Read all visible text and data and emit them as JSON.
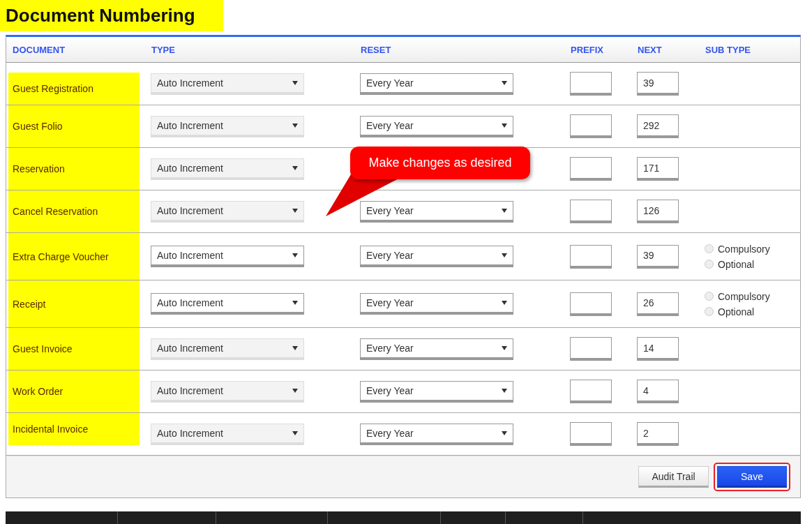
{
  "title": "Document Numbering",
  "columns": [
    "DOCUMENT",
    "TYPE",
    "RESET",
    "PREFIX",
    "NEXT",
    "SUB TYPE"
  ],
  "rows": [
    {
      "document": "Guest Registration",
      "type": {
        "value": "Auto Increment",
        "disabled": true
      },
      "reset": "Every Year",
      "prefix": "",
      "next": "39"
    },
    {
      "document": "Guest Folio",
      "type": {
        "value": "Auto Increment",
        "disabled": true
      },
      "reset": "Every Year",
      "prefix": "",
      "next": "292"
    },
    {
      "document": "Reservation",
      "type": {
        "value": "Auto Increment",
        "disabled": true
      },
      "prefix": "",
      "next": "171"
    },
    {
      "document": "Cancel Reservation",
      "type": {
        "value": "Auto Increment",
        "disabled": true
      },
      "reset": "Every Year",
      "prefix": "",
      "next": "126"
    },
    {
      "document": "Extra Charge Voucher",
      "type": {
        "value": "Auto Increment",
        "disabled": false
      },
      "reset": "Every Year",
      "prefix": "",
      "next": "39",
      "sub_types": [
        {
          "label": "Compulsory",
          "selected": false
        },
        {
          "label": "Optional",
          "selected": false
        }
      ]
    },
    {
      "document": "Receipt",
      "type": {
        "value": "Auto Increment",
        "disabled": false
      },
      "reset": "Every Year",
      "prefix": "",
      "next": "26",
      "sub_types": [
        {
          "label": "Compulsory",
          "selected": false
        },
        {
          "label": "Optional",
          "selected": false
        }
      ]
    },
    {
      "document": "Guest Invoice",
      "type": {
        "value": "Auto Increment",
        "disabled": true
      },
      "reset": "Every Year",
      "prefix": "",
      "next": "14"
    },
    {
      "document": "Work Order",
      "type": {
        "value": "Auto Increment",
        "disabled": true
      },
      "reset": "Every Year",
      "prefix": "",
      "next": "4"
    },
    {
      "document": "Incidental Invoice",
      "type": {
        "value": "Auto Increment",
        "disabled": true
      },
      "reset": "Every Year",
      "prefix": "",
      "next": "2"
    }
  ],
  "callout": "Make changes as desired",
  "buttons": [
    {
      "label": "Audit Trail",
      "kind": "secondary"
    },
    {
      "label": "Save",
      "kind": "primary",
      "highlighted": true
    }
  ]
}
